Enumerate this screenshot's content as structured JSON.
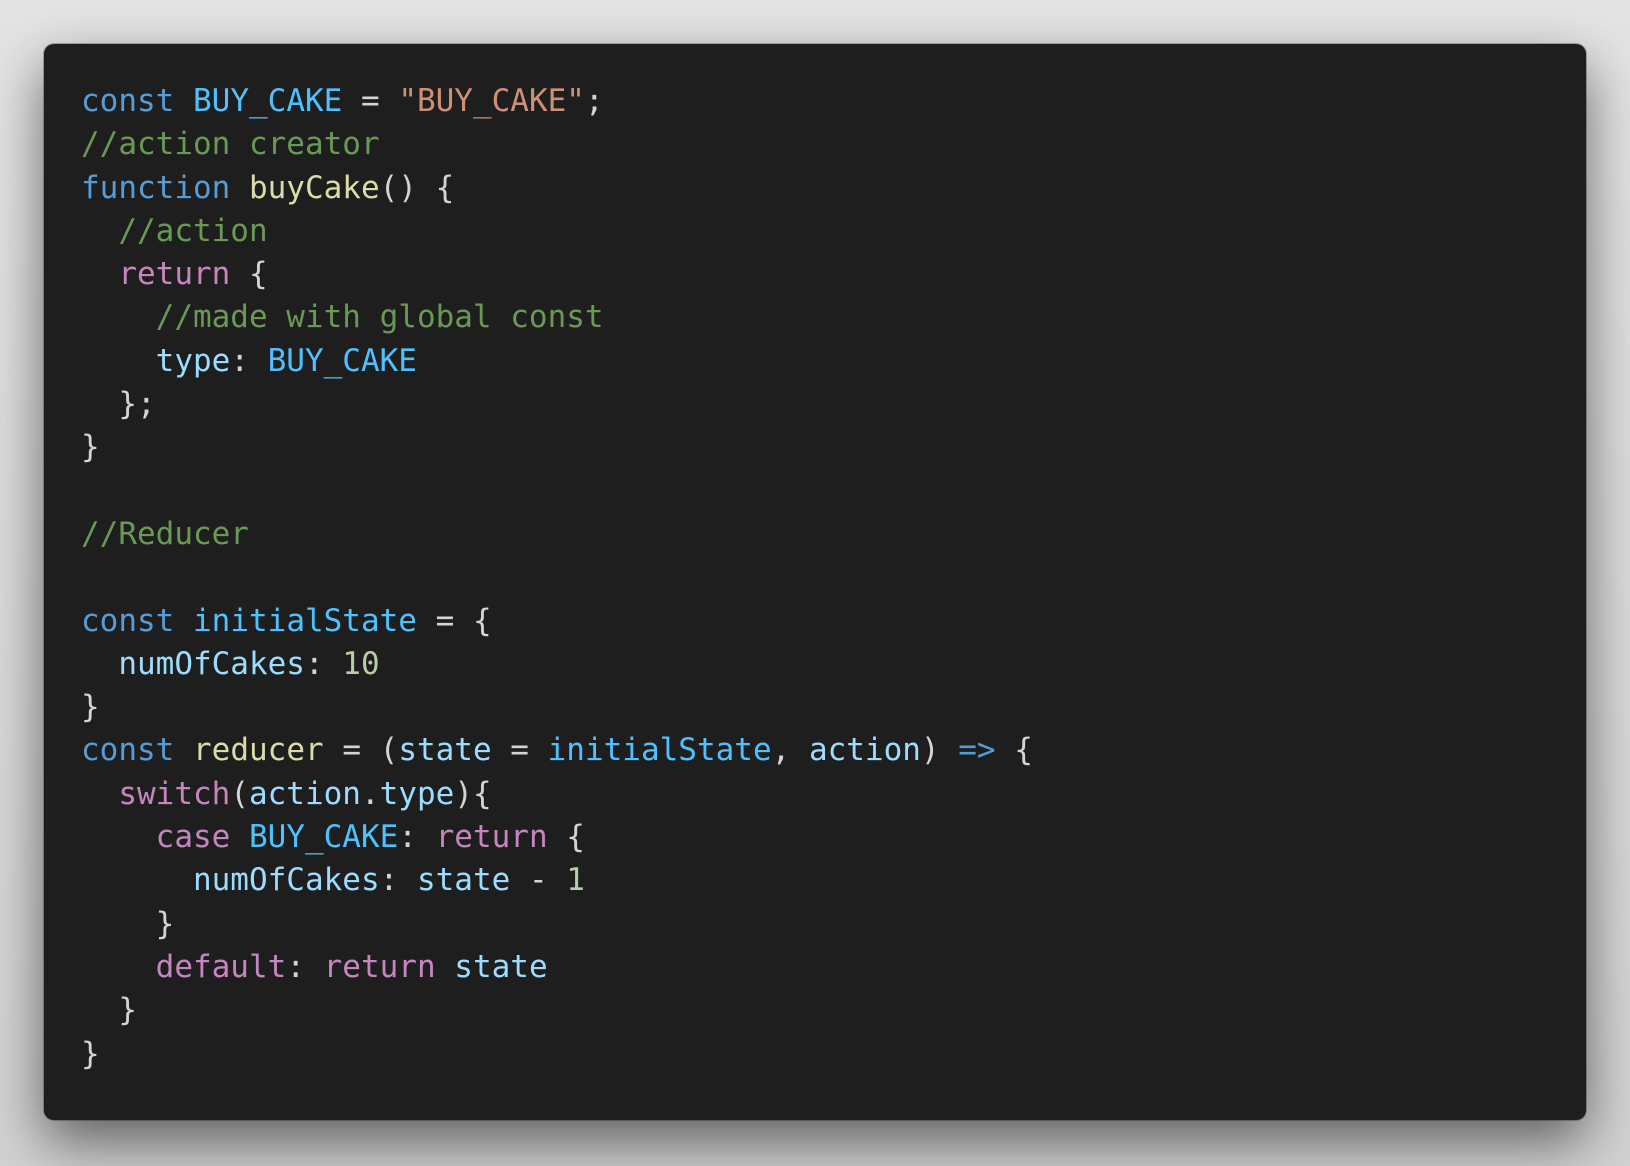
{
  "colors": {
    "background": "#1e1e1e",
    "keyword": "#569cd6",
    "control": "#c586c0",
    "constant": "#4fc1ff",
    "variable": "#9cdcfe",
    "function": "#dcdcaa",
    "string": "#ce9178",
    "comment": "#6a9955",
    "number": "#b5cea8",
    "punctuation": "#d4d4d4"
  },
  "code": {
    "lines": [
      [
        {
          "t": "keyword",
          "v": "const"
        },
        {
          "t": "punct",
          "v": " "
        },
        {
          "t": "const-name",
          "v": "BUY_CAKE"
        },
        {
          "t": "punct",
          "v": " = "
        },
        {
          "t": "string",
          "v": "\"BUY_CAKE\""
        },
        {
          "t": "punct",
          "v": ";"
        }
      ],
      [
        {
          "t": "comment",
          "v": "//action creator"
        }
      ],
      [
        {
          "t": "keyword",
          "v": "function"
        },
        {
          "t": "punct",
          "v": " "
        },
        {
          "t": "function",
          "v": "buyCake"
        },
        {
          "t": "punct",
          "v": "() {"
        }
      ],
      [
        {
          "t": "punct",
          "v": "  "
        },
        {
          "t": "comment",
          "v": "//action"
        }
      ],
      [
        {
          "t": "punct",
          "v": "  "
        },
        {
          "t": "control",
          "v": "return"
        },
        {
          "t": "punct",
          "v": " {"
        }
      ],
      [
        {
          "t": "punct",
          "v": "    "
        },
        {
          "t": "comment",
          "v": "//made with global const"
        }
      ],
      [
        {
          "t": "punct",
          "v": "    "
        },
        {
          "t": "variable",
          "v": "type"
        },
        {
          "t": "punct",
          "v": ": "
        },
        {
          "t": "const-name",
          "v": "BUY_CAKE"
        }
      ],
      [
        {
          "t": "punct",
          "v": "  };"
        }
      ],
      [
        {
          "t": "punct",
          "v": "}"
        }
      ],
      [
        {
          "t": "punct",
          "v": ""
        }
      ],
      [
        {
          "t": "comment",
          "v": "//Reducer"
        }
      ],
      [
        {
          "t": "punct",
          "v": ""
        }
      ],
      [
        {
          "t": "keyword",
          "v": "const"
        },
        {
          "t": "punct",
          "v": " "
        },
        {
          "t": "const-name",
          "v": "initialState"
        },
        {
          "t": "punct",
          "v": " = {"
        }
      ],
      [
        {
          "t": "punct",
          "v": "  "
        },
        {
          "t": "variable",
          "v": "numOfCakes"
        },
        {
          "t": "punct",
          "v": ": "
        },
        {
          "t": "number",
          "v": "10"
        }
      ],
      [
        {
          "t": "punct",
          "v": "}"
        }
      ],
      [
        {
          "t": "keyword",
          "v": "const"
        },
        {
          "t": "punct",
          "v": " "
        },
        {
          "t": "function",
          "v": "reducer"
        },
        {
          "t": "punct",
          "v": " = ("
        },
        {
          "t": "variable",
          "v": "state"
        },
        {
          "t": "punct",
          "v": " = "
        },
        {
          "t": "const-name",
          "v": "initialState"
        },
        {
          "t": "punct",
          "v": ", "
        },
        {
          "t": "variable",
          "v": "action"
        },
        {
          "t": "punct",
          "v": ") "
        },
        {
          "t": "keyword",
          "v": "=>"
        },
        {
          "t": "punct",
          "v": " {"
        }
      ],
      [
        {
          "t": "punct",
          "v": "  "
        },
        {
          "t": "control",
          "v": "switch"
        },
        {
          "t": "punct",
          "v": "("
        },
        {
          "t": "variable",
          "v": "action"
        },
        {
          "t": "punct",
          "v": "."
        },
        {
          "t": "variable",
          "v": "type"
        },
        {
          "t": "punct",
          "v": "){"
        }
      ],
      [
        {
          "t": "punct",
          "v": "    "
        },
        {
          "t": "control",
          "v": "case"
        },
        {
          "t": "punct",
          "v": " "
        },
        {
          "t": "const-name",
          "v": "BUY_CAKE"
        },
        {
          "t": "punct",
          "v": ": "
        },
        {
          "t": "control",
          "v": "return"
        },
        {
          "t": "punct",
          "v": " {"
        }
      ],
      [
        {
          "t": "punct",
          "v": "      "
        },
        {
          "t": "variable",
          "v": "numOfCakes"
        },
        {
          "t": "punct",
          "v": ": "
        },
        {
          "t": "variable",
          "v": "state"
        },
        {
          "t": "punct",
          "v": " - "
        },
        {
          "t": "number",
          "v": "1"
        }
      ],
      [
        {
          "t": "punct",
          "v": "    }"
        }
      ],
      [
        {
          "t": "punct",
          "v": "    "
        },
        {
          "t": "control",
          "v": "default"
        },
        {
          "t": "punct",
          "v": ": "
        },
        {
          "t": "control",
          "v": "return"
        },
        {
          "t": "punct",
          "v": " "
        },
        {
          "t": "variable",
          "v": "state"
        }
      ],
      [
        {
          "t": "punct",
          "v": "  }"
        }
      ],
      [
        {
          "t": "punct",
          "v": "}"
        }
      ]
    ]
  }
}
